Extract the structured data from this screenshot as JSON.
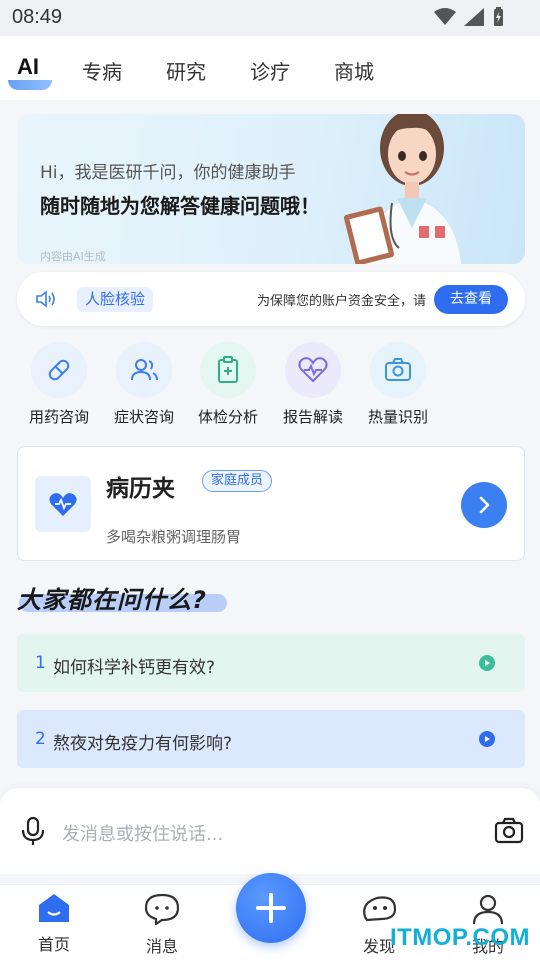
{
  "status_bar": {
    "time": "08:49"
  },
  "top_tabs": [
    "AI",
    "专病",
    "研究",
    "诊疗",
    "商城"
  ],
  "hero": {
    "line1": "Hi，我是医研千问，你的健康助手",
    "line2": "随时随地为您解答健康问题哦！",
    "note": "内容由AI生成"
  },
  "notice": {
    "tag": "人脸核验",
    "text": "为保障您的账户资金安全，请",
    "button": "去查看"
  },
  "functions": [
    {
      "label": "用药咨询",
      "icon": "pill-icon"
    },
    {
      "label": "症状咨询",
      "icon": "people-icon"
    },
    {
      "label": "体检分析",
      "icon": "clipboard-plus-icon"
    },
    {
      "label": "报告解读",
      "icon": "heart-pulse-icon"
    },
    {
      "label": "热量识别",
      "icon": "camera-icon"
    }
  ],
  "record": {
    "title": "病历夹",
    "badge": "家庭成员",
    "subtitle": "多喝杂粮粥调理肠胃"
  },
  "section_title": "大家都在问什么?",
  "questions": [
    {
      "num": "1",
      "text": "如何科学补钙更有效?"
    },
    {
      "num": "2",
      "text": "熬夜对免疫力有何影响?"
    }
  ],
  "input": {
    "placeholder": "发消息或按住说话..."
  },
  "bottom_nav": [
    {
      "label": "首页",
      "icon": "home-icon"
    },
    {
      "label": "消息",
      "icon": "chat-icon"
    },
    {
      "label": "发现",
      "icon": "discover-icon"
    },
    {
      "label": "我的",
      "icon": "profile-icon"
    }
  ],
  "watermark": "ITMOP.COM",
  "colors": {
    "accent": "#2f6df0",
    "green_accent": "#3bbf9a",
    "page_bg": "#f4f6f9"
  }
}
